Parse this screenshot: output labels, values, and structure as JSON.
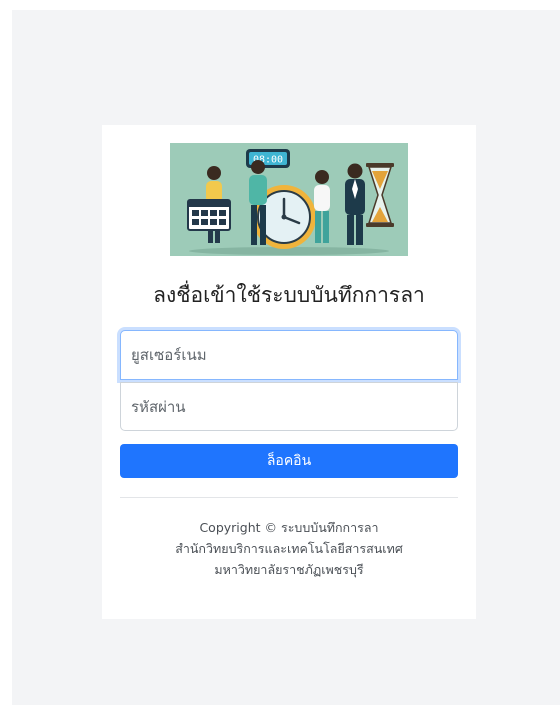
{
  "login": {
    "title": "ลงชื่อเข้าใช้ระบบบันทึกการลา",
    "username_placeholder": "ยูสเซอร์เนม",
    "password_placeholder": "รหัสผ่าน",
    "login_button": "ล็อคอิน",
    "banner_clock_text": "08:00"
  },
  "footer": {
    "copyright": "Copyright © ระบบบันทึกการลา",
    "office": "สำนักวิทยบริการและเทคโนโลยีสารสนเทศ",
    "university": "มหาวิทยาลัยราชภัฏเพชรบุรี"
  },
  "colors": {
    "primary": "#1f75fe",
    "banner_background": "#9dcbb8",
    "page_background": "#f3f4f6"
  }
}
